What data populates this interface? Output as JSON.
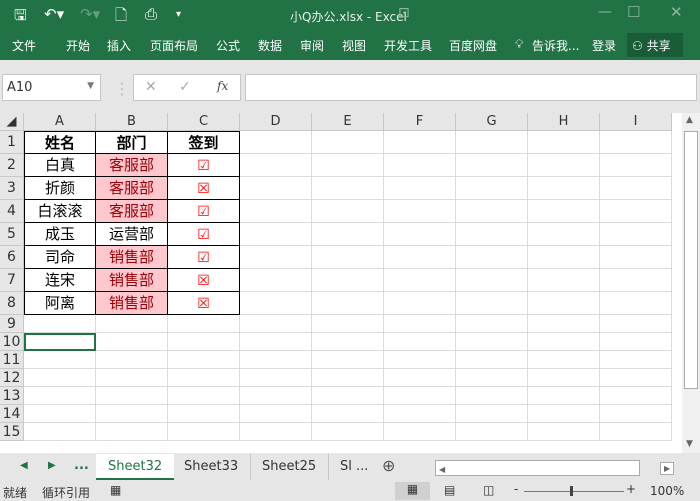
{
  "title": "小Q办公.xlsx - Excel",
  "ribbon": {
    "tabs": [
      "文件",
      "开始",
      "插入",
      "页面布局",
      "公式",
      "数据",
      "审阅",
      "视图",
      "开发工具",
      "百度网盘"
    ],
    "tell_me": "告诉我...",
    "login": "登录",
    "share": "共享"
  },
  "formula_bar": {
    "name_box": "A10",
    "formula": ""
  },
  "columns": [
    "A",
    "B",
    "C",
    "D",
    "E",
    "F",
    "G",
    "H",
    "I"
  ],
  "rows": [
    "1",
    "2",
    "3",
    "4",
    "5",
    "6",
    "7",
    "8",
    "9",
    "10",
    "11",
    "12",
    "13",
    "14",
    "15"
  ],
  "table": {
    "headers": [
      "姓名",
      "部门",
      "签到"
    ],
    "data": [
      {
        "name": "白真",
        "dept": "客服部",
        "checked": true,
        "highlight": true
      },
      {
        "name": "折颜",
        "dept": "客服部",
        "checked": false,
        "highlight": true
      },
      {
        "name": "白滚滚",
        "dept": "客服部",
        "checked": true,
        "highlight": true
      },
      {
        "name": "成玉",
        "dept": "运营部",
        "checked": true,
        "highlight": false
      },
      {
        "name": "司命",
        "dept": "销售部",
        "checked": true,
        "highlight": true
      },
      {
        "name": "连宋",
        "dept": "销售部",
        "checked": false,
        "highlight": true
      },
      {
        "name": "阿离",
        "dept": "销售部",
        "checked": false,
        "highlight": true
      }
    ],
    "check_glyph": "☑",
    "cross_glyph": "☒"
  },
  "colors": {
    "brand": "#217346",
    "highlight_fill": "#ffc7ce",
    "highlight_text": "#9c0006",
    "mark": "#ff0000"
  },
  "sheets": {
    "tabs": [
      "Sheet32",
      "Sheet33",
      "Sheet25",
      "Sl ..."
    ],
    "active": "Sheet32",
    "more": "..."
  },
  "status": {
    "ready": "就绪",
    "circular": "循环引用",
    "zoom": "100%"
  }
}
